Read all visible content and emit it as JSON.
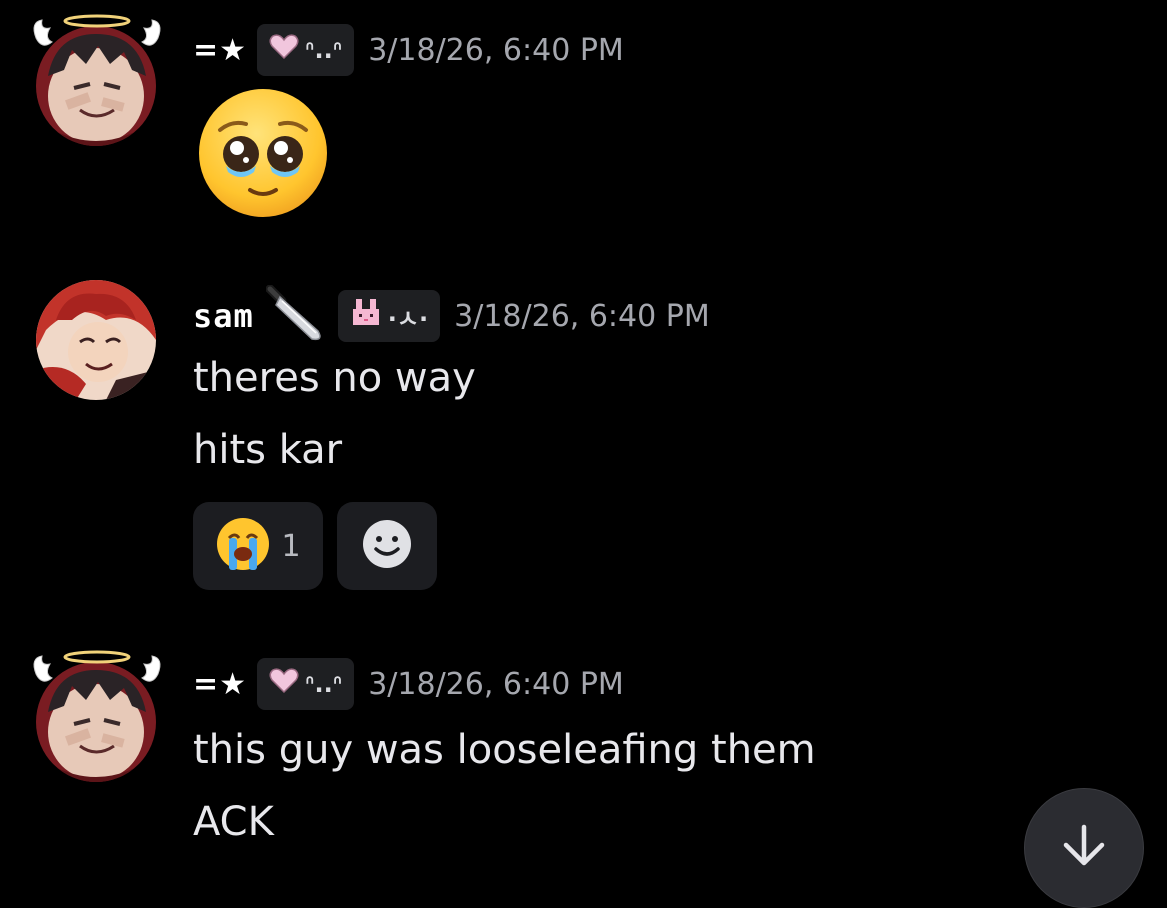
{
  "messages": [
    {
      "username": "=★",
      "tag": "ᐢ..ᐢ",
      "tag_icon": "pink-heart-icon",
      "timestamp": "3/18/26, 6:40 PM",
      "content": "pleading-face-emoji",
      "avatar": "avatar-angel-boy"
    },
    {
      "username": "sam",
      "user_icon": "knife-icon",
      "tag": "·ㅅ·",
      "tag_icon": "pink-bunny-icon",
      "timestamp": "3/18/26, 6:40 PM",
      "lines": [
        "theres no way",
        "hits kar"
      ],
      "reactions": [
        {
          "emoji": "loudly-crying-face-emoji",
          "count": "1"
        },
        {
          "emoji": "add-reaction-icon"
        }
      ],
      "avatar": "avatar-red-hair"
    },
    {
      "username": "=★",
      "tag": "ᐢ..ᐢ",
      "tag_icon": "pink-heart-icon",
      "timestamp": "3/18/26, 6:40 PM",
      "lines": [
        "this guy was looseleafing them",
        "ACK"
      ],
      "avatar": "avatar-angel-boy"
    }
  ],
  "scroll_button": {
    "icon": "arrow-down-icon"
  },
  "colors": {
    "background": "#000000",
    "text": "#e8e8ec",
    "timestamp": "#a5a7ae",
    "tag_bg": "#1e1f22",
    "reaction_bg": "#1c1d21",
    "scroll_btn_bg": "#2b2c31"
  }
}
